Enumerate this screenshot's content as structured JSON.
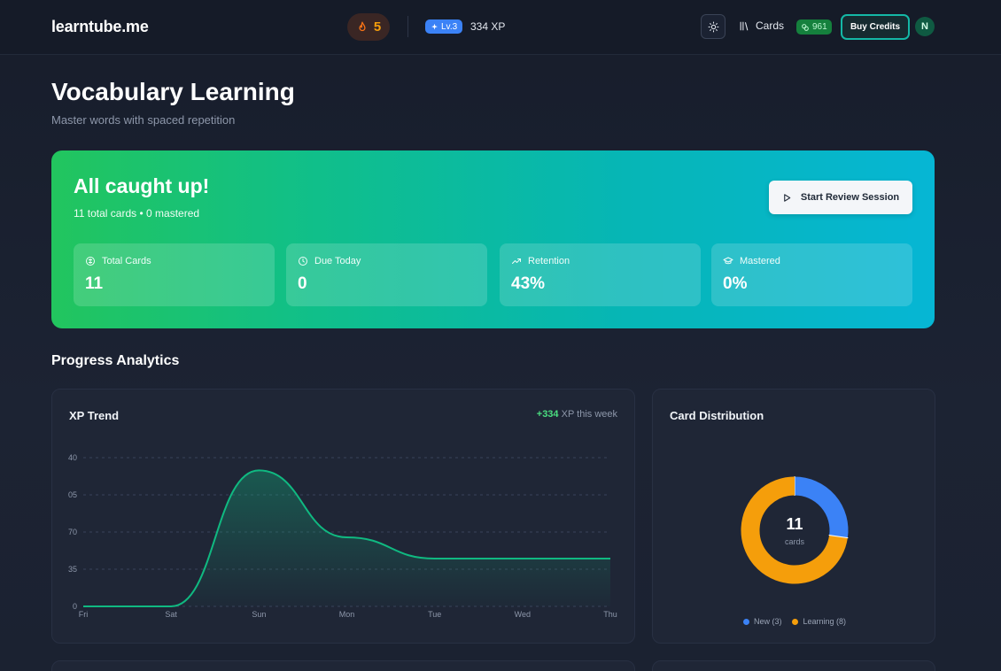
{
  "header": {
    "brand": "learntube.me",
    "streak_count": "5",
    "level_badge": "Lv.3",
    "xp": "334 XP",
    "cards_label": "Cards",
    "credits": "961",
    "buy_credits_label": "Buy Credits",
    "avatar_initial": "N"
  },
  "page": {
    "title": "Vocabulary Learning",
    "subtitle": "Master words with spaced repetition"
  },
  "hero": {
    "title": "All caught up!",
    "subtitle": "11 total cards • 0 mastered",
    "review_button": "Start Review Session",
    "stats": [
      {
        "label": "Total Cards",
        "value": "11",
        "icon": "brain-icon"
      },
      {
        "label": "Due Today",
        "value": "0",
        "icon": "clock-icon"
      },
      {
        "label": "Retention",
        "value": "43%",
        "icon": "trending-up-icon"
      },
      {
        "label": "Mastered",
        "value": "0%",
        "icon": "graduation-cap-icon"
      }
    ]
  },
  "analytics": {
    "section_title": "Progress Analytics",
    "xp_trend_title": "XP Trend",
    "week_gain": "+334",
    "week_suffix": "XP this week",
    "distribution_title": "Card Distribution",
    "total_cards_center": "11",
    "center_unit": "cards",
    "legend": [
      {
        "label": "New (3)",
        "color": "#3b82f6"
      },
      {
        "label": "Learning (8)",
        "color": "#f59e0b"
      }
    ]
  },
  "colors": {
    "accent_green": "#22c55e",
    "accent_cyan": "#06b6d4",
    "line": "#10b981",
    "new": "#3b82f6",
    "learning": "#f59e0b"
  },
  "chart_data": [
    {
      "type": "area",
      "title": "XP Trend",
      "categories": [
        "Fri",
        "Sat",
        "Sun",
        "Mon",
        "Tue",
        "Wed",
        "Thu"
      ],
      "y_tick_labels": [
        "0",
        "35",
        "70",
        "05",
        "40"
      ],
      "ylim": [
        0,
        140
      ],
      "values": [
        0,
        0,
        128,
        65,
        45,
        45,
        45
      ],
      "grid": true
    },
    {
      "type": "pie",
      "title": "Card Distribution",
      "categories": [
        "New",
        "Learning"
      ],
      "values": [
        3,
        8
      ]
    }
  ]
}
